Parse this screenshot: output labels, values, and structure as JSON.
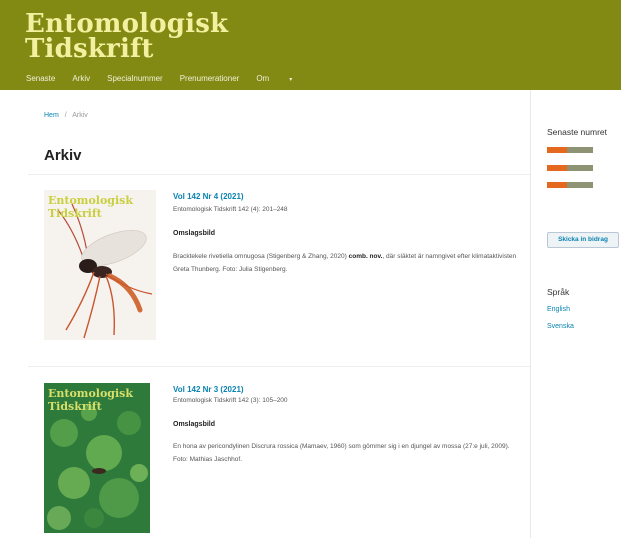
{
  "header": {
    "title_line1": "Entomologisk",
    "title_line2": "Tidskrift",
    "nav": [
      {
        "label": "Senaste"
      },
      {
        "label": "Arkiv"
      },
      {
        "label": "Specialnummer"
      },
      {
        "label": "Prenumerationer"
      },
      {
        "label": "Om"
      }
    ],
    "nav_caret": "▾"
  },
  "breadcrumb": {
    "home": "Hem",
    "separator": "/",
    "current": "Arkiv"
  },
  "page_title": "Arkiv",
  "issues": [
    {
      "title": "Vol 142 Nr 4 (2021)",
      "series": "Entomologisk Tidskrift 142 (4): 201–248",
      "omslag_label": "Omslagsbild",
      "desc_prefix": "Bracktekele rivetiella omnugosa (Stigenberg & Zhang, 2020) ",
      "desc_bold": "comb. nov.",
      "desc_suffix": ", där släktet är namngivet efter klimataktivisten Greta Thunberg. Foto: Julia Stigenberg.",
      "cover_title_1": "Entomologisk",
      "cover_title_2": "Tidskrift"
    },
    {
      "title": "Vol 142 Nr 3 (2021)",
      "series": "Entomologisk Tidskrift 142 (3): 105–200",
      "omslag_label": "Omslagsbild",
      "desc_prefix": "En hona av pericondylinen Discrura rossica (Mamaev, 1960) som gömmer sig i en djungel av mossa (27:e juli, 2009). Foto: Mathias Jaschhof.",
      "desc_bold": "",
      "desc_suffix": "",
      "cover_title_1": "Entomologisk",
      "cover_title_2": "Tidskrift"
    }
  ],
  "sidebar": {
    "latest_heading": "Senaste numret",
    "subscribe_button": "Skicka in bidrag",
    "language_heading": "Språk",
    "languages": [
      "English",
      "Svenska"
    ]
  },
  "colors": {
    "header_bg": "#828a14",
    "title_color": "#f3f0a0",
    "link": "#0a83b0",
    "badge_orange": "#e4691f",
    "badge_gray": "#8e9473"
  }
}
